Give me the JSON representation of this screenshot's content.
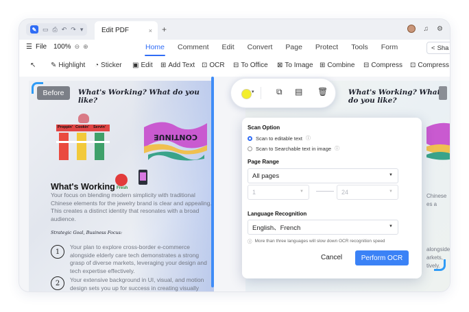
{
  "window": {
    "tab_title": "Edit PDF",
    "tab_close": "×",
    "new_tab": "+",
    "quick_icons": [
      "save-icon",
      "print-icon",
      "undo-icon",
      "redo-icon",
      "dropdown-icon"
    ]
  },
  "menubar": {
    "file_label": "File",
    "zoom_value": "100%",
    "zoom_out": "⊖",
    "zoom_in": "⊕",
    "menus": [
      "Home",
      "Comment",
      "Edit",
      "Convert",
      "Page",
      "Protect",
      "Tools",
      "Form"
    ],
    "active_menu": "Home",
    "share_label": "Sha"
  },
  "toolbar": {
    "tools": [
      {
        "label": "",
        "icon": "select-cursor-icon"
      },
      {
        "label": "Highlight",
        "icon": "highlight-icon"
      },
      {
        "label": "Sticker",
        "icon": "sticker-icon"
      },
      {
        "label": "Edit",
        "icon": "edit-icon"
      },
      {
        "label": "Add Text",
        "icon": "add-text-icon"
      },
      {
        "label": "OCR",
        "icon": "ocr-icon"
      },
      {
        "label": "To Office",
        "icon": "to-office-icon"
      },
      {
        "label": "To Image",
        "icon": "to-image-icon"
      },
      {
        "label": "Combine",
        "icon": "combine-icon"
      },
      {
        "label": "Compress",
        "icon": "compress-icon"
      },
      {
        "label": "Compress",
        "icon": "compress-icon"
      }
    ]
  },
  "document": {
    "before_label": "Before",
    "title": "What's Working? What do you like?",
    "title_right": "What's Working? What do you like?",
    "stall_labels": [
      "Proppin'",
      "Cookin'",
      "Servin'"
    ],
    "flag_text": "CONTINUE",
    "fresh_label": "Fresh",
    "heading": "What's Working",
    "intro": "Your focus on blending modern simplicity with traditional Chinese elements for the jewelry brand is clear and appealing. This creates a distinct identity that resonates with a broad audience.",
    "strategic_label": "Strategic Goal, Business Focus:",
    "item1_num": "1",
    "item1": "Your plan to explore cross-border e-commerce alongside elderly care tech demonstrates a strong grasp of diverse markets, leveraging your design and tech expertise effectively.",
    "item2_num": "2",
    "item2": "Your extensive background in UI, visual, and motion design sets you up for success in creating visually compelling and user-",
    "right_fragments": [
      "Chinese",
      "es a",
      "alongside",
      "arkets,",
      "tively."
    ]
  },
  "float_toolbar": {
    "color": "#f3ee2b",
    "icons": [
      "copy-icon",
      "comment-icon",
      "delete-icon"
    ]
  },
  "ocr_dialog": {
    "scan_option_title": "Scan Option",
    "scan_editable": "Scan to editable text",
    "scan_searchable": "Scan to Searchable text in image",
    "page_range_title": "Page Range",
    "page_range_value": "All pages",
    "from_page": "1",
    "to_page": "24",
    "language_title": "Language Recognition",
    "language_value": "English、French",
    "note": "More than three languages will slow down OCR recognition speed",
    "cancel_label": "Cancel",
    "perform_label": "Perform OCR"
  }
}
